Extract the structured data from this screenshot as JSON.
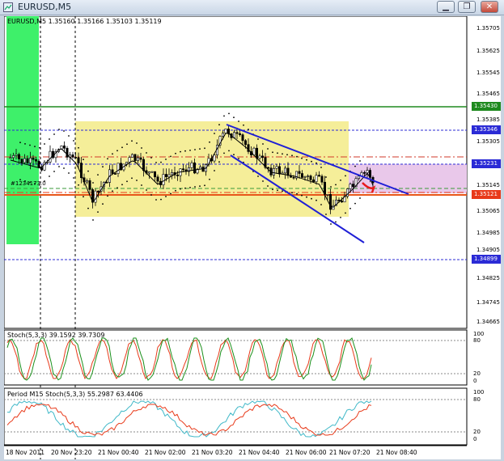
{
  "window": {
    "title": "EURUSD,M5",
    "buttons": [
      "minimize-icon",
      "restore-icon",
      "close-icon"
    ]
  },
  "main_chart": {
    "header": "EURUSD,M5  1.35160 1.35166 1.35103 1.35119",
    "object_label": "#1234173.0",
    "price_ticks": [
      "1.35705",
      "1.35625",
      "1.35545",
      "1.35465",
      "1.35385",
      "1.35305",
      "1.35145",
      "1.35065",
      "1.34985",
      "1.34905",
      "1.34825",
      "1.34745",
      "1.34665"
    ],
    "price_badges": [
      {
        "text": "1.35430",
        "color": "#1e8a1e"
      },
      {
        "text": "1.35346",
        "color": "#2b2bd6"
      },
      {
        "text": "1.35231",
        "color": "#2b2bd6"
      },
      {
        "text": "1.35121",
        "color": "#e83a1a"
      },
      {
        "text": "1.34899",
        "color": "#2b2bd6"
      }
    ]
  },
  "stoch_panel": {
    "header": "Stoch(5,3,3) 39.1592 39.7309",
    "ticks": [
      "100",
      "80",
      "20",
      "0"
    ]
  },
  "period_panel": {
    "header": "Period M15 Stoch(5,3,3) 55.2987 63.4406",
    "ticks": [
      "100",
      "80",
      "20",
      "0"
    ]
  },
  "time_axis": {
    "labels": [
      "18 Nov 2011",
      "20 Nov 23:20",
      "21 Nov 00:40",
      "21 Nov 02:00",
      "21 Nov 03:20",
      "21 Nov 04:40",
      "21 Nov 06:00",
      "21 Nov 07:20",
      "21 Nov 08:40"
    ]
  },
  "colors": {
    "green_zone": "#3ef06a",
    "yellow_zone": "#f5ee99",
    "pink_zone": "#e9c8ea",
    "channel": "#1f1fd6",
    "signal_red": "#e81a1a",
    "stoch_green": "#1a8f1a",
    "stoch_red": "#e83a1a",
    "stoch_cyan": "#3fb8c8"
  }
}
